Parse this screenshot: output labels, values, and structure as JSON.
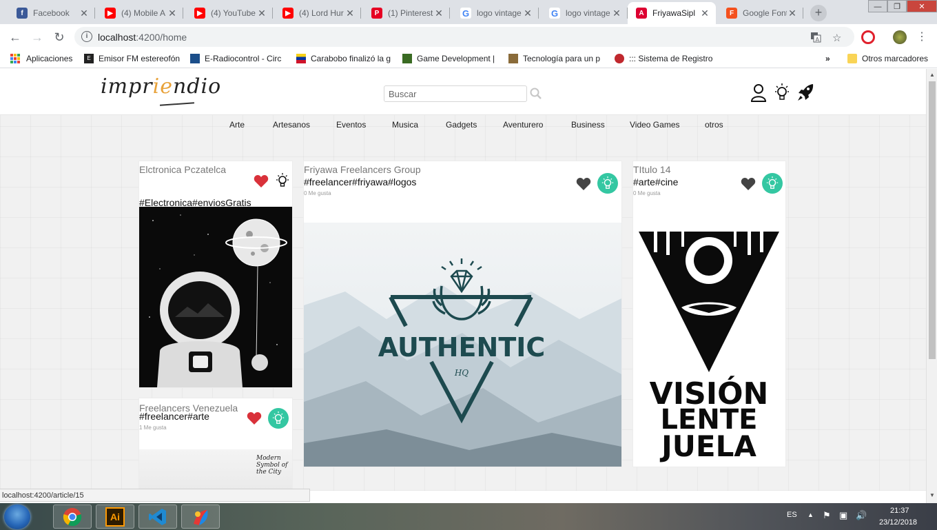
{
  "browser": {
    "tabs": [
      {
        "title": "Facebook",
        "icon": "facebook-icon",
        "color": "#3b5998",
        "glyph": "f"
      },
      {
        "title": "(4) Mobile A",
        "icon": "youtube-icon",
        "color": "#ff0000",
        "glyph": "▶"
      },
      {
        "title": "(4) YouTube",
        "icon": "youtube-icon",
        "color": "#ff0000",
        "glyph": "▶"
      },
      {
        "title": "(4) Lord Hur",
        "icon": "youtube-icon",
        "color": "#ff0000",
        "glyph": "▶"
      },
      {
        "title": "(1) Pinterest",
        "icon": "pinterest-icon",
        "color": "#e60023",
        "glyph": "P"
      },
      {
        "title": "logo vintage",
        "icon": "google-icon",
        "color": "#4285f4",
        "glyph": "G"
      },
      {
        "title": "logo vintage",
        "icon": "google-icon",
        "color": "#4285f4",
        "glyph": "G"
      },
      {
        "title": "FriyawaSipl",
        "icon": "angular-icon",
        "color": "#dd0031",
        "glyph": "A",
        "active": true
      },
      {
        "title": "Google Font",
        "icon": "google-fonts-icon",
        "color": "#f4511e",
        "glyph": "F"
      }
    ],
    "url_host": "localhost",
    "url_path": ":4200/home",
    "bookmarks": {
      "apps_label": "Aplicaciones",
      "items": [
        "Emisor FM estereofón",
        "E-Radiocontrol - Circ",
        "Carabobo finalizó la g",
        "Game Development |",
        "Tecnología para un p",
        "::: Sistema de Registro"
      ],
      "more": "»",
      "other": "Otros marcadores"
    },
    "status_url": "localhost:4200/article/15"
  },
  "site": {
    "logo_text": "impriendio",
    "search_placeholder": "Buscar",
    "categories": [
      "Arte",
      "Artesanos",
      "Eventos",
      "Musica",
      "Gadgets",
      "Aventurero",
      "Business",
      "Video Games",
      "otros"
    ]
  },
  "cards": [
    {
      "title": "Elctronica Pczatelca",
      "tags": "#Electronica#enviosGratis",
      "likes": ""
    },
    {
      "title": "Freelancers Venezuela",
      "tags": "#freelancer#arte",
      "likes": "1 Me gusta",
      "image_text": "Modern Symbol of the City"
    },
    {
      "title": "Friyawa Freelancers Group",
      "tags": "#freelancer#friyawa#logos",
      "likes": "0 Me gusta",
      "image_text": "AUTHENTIC",
      "image_subtext": "HQ"
    },
    {
      "title": "TItulo 14",
      "tags": "#arte#cine",
      "likes": "0 Me gusta",
      "image_text": [
        "VISIÓN",
        "LENTE",
        "JUELA"
      ]
    }
  ],
  "colors": {
    "heart_active": "#d9313a",
    "heart_inactive": "#444444",
    "bulb_active": "#34c7a2",
    "authentic_teal": "#1d4a4f"
  },
  "taskbar": {
    "lang": "ES",
    "time": "21:37",
    "date": "23/12/2018"
  }
}
